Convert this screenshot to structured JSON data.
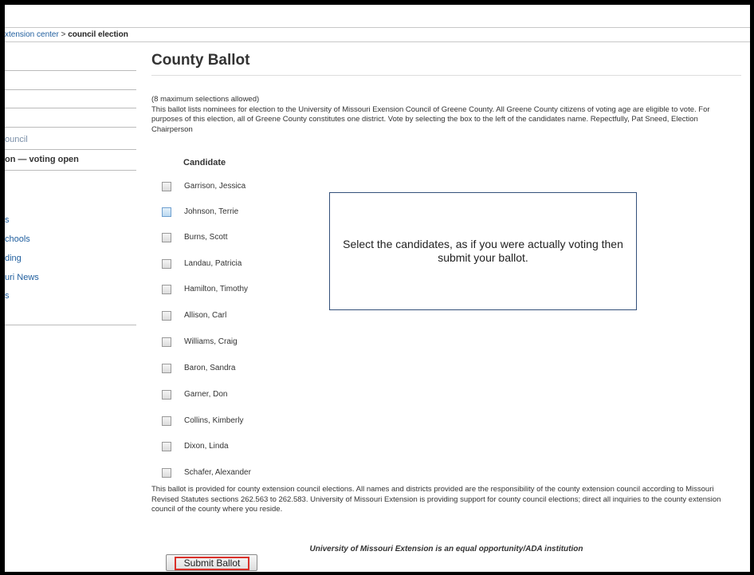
{
  "breadcrumb": {
    "link_text": "xtension center",
    "separator": ">",
    "current": "council election"
  },
  "sidebar": {
    "items": [
      {
        "label": "ouncil"
      },
      {
        "label": "on — voting open"
      },
      {
        "label": "s"
      },
      {
        "label": "chools"
      },
      {
        "label": "ding"
      },
      {
        "label": "uri News"
      },
      {
        "label": "s"
      }
    ]
  },
  "ballot": {
    "title": "County Ballot",
    "max_note": "(8 maximum selections allowed)",
    "description": "This ballot lists nominees for election to the University of Missouri Exension Council of Greene County. All Greene County citizens of voting age are eligible to vote. For purposes of this election, all of Greene County constitutes one district. Vote by selecting the box to the left of the candidates name. Repectfully, Pat Sneed, Election Chairperson",
    "candidate_header": "Candidate",
    "candidates": [
      "Garrison, Jessica",
      "Johnson, Terrie",
      "Burns, Scott",
      "Landau, Patricia",
      "Hamilton, Timothy",
      "Allison, Carl",
      "Williams, Craig",
      "Baron, Sandra",
      "Garner, Don",
      "Collins, Kimberly",
      "Dixon, Linda",
      "Schafer, Alexander"
    ],
    "disclaimer": "This ballot is provided for county extension council elections. All names and districts provided are the responsibility of the county extension council according to Missouri Revised Statutes sections 262.563 to 262.583. University of Missouri Extension is providing support for county council elections; direct all inquiries to the county extension council of the county where you reside.",
    "tagline": "University of Missouri Extension is an equal opportunity/ADA institution",
    "submit_label": "Submit Ballot"
  },
  "instruction_callout": "Select the candidates, as if you were actually voting then submit your ballot."
}
